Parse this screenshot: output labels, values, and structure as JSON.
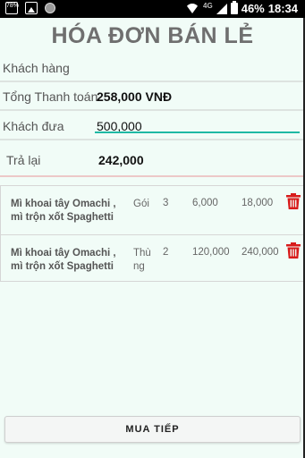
{
  "status_bar": {
    "left_box_text": "78%",
    "network": "4G",
    "battery": "46%",
    "time": "18:34"
  },
  "page": {
    "title": "HÓA ĐƠN BÁN LẺ"
  },
  "summary": {
    "customer_label": "Khách hàng",
    "total_label": "Tổng Thanh toán",
    "total_value": "258,000 VNĐ",
    "paid_label": "Khách đưa",
    "paid_value": "500,000",
    "change_label": "Trả lại",
    "change_value": "242,000"
  },
  "items": [
    {
      "name_line1": "Mì khoai tây Omachi ,",
      "name_line2": "mì trộn xốt Spaghetti",
      "unit_line1": "Gói",
      "unit_line2": "",
      "qty": "3",
      "price": "6,000",
      "total": "18,000"
    },
    {
      "name_line1": "Mì khoai tây Omachi ,",
      "name_line2": "mì trộn xốt Spaghetti",
      "unit_line1": "Thù",
      "unit_line2": "ng",
      "qty": "2",
      "price": "120,000",
      "total": "240,000"
    }
  ],
  "actions": {
    "continue_label": "MUA TIẾP"
  },
  "colors": {
    "background": "#f1fcf7",
    "accent": "#1fb8a4",
    "trash": "#d81b1b",
    "title": "#6f6f6f"
  }
}
